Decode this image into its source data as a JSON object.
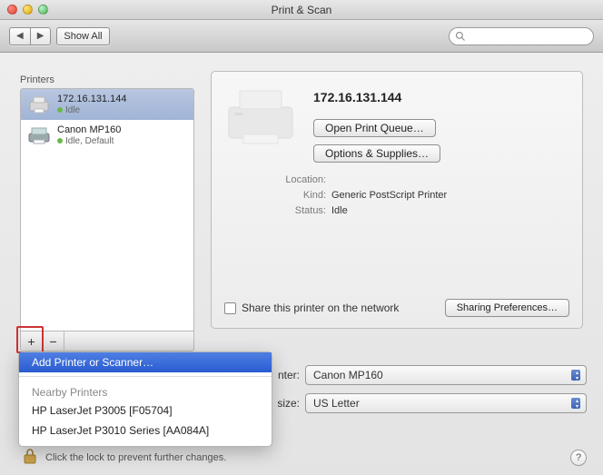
{
  "window": {
    "title": "Print & Scan"
  },
  "toolbar": {
    "show_all": "Show All"
  },
  "sidebar": {
    "heading": "Printers",
    "items": [
      {
        "name": "172.16.131.144",
        "status": "Idle",
        "selected": true
      },
      {
        "name": "Canon MP160",
        "status": "Idle, Default",
        "selected": false
      }
    ]
  },
  "detail": {
    "title": "172.16.131.144",
    "open_queue": "Open Print Queue…",
    "options_supplies": "Options & Supplies…",
    "labels": {
      "location": "Location:",
      "kind": "Kind:",
      "status": "Status:"
    },
    "values": {
      "location": "",
      "kind": "Generic PostScript Printer",
      "status": "Idle"
    },
    "share_label": "Share this printer on the network",
    "sharing_prefs": "Sharing Preferences…"
  },
  "popup": {
    "add": "Add Printer or Scanner…",
    "nearby_heading": "Nearby Printers",
    "nearby": [
      "HP LaserJet P3005 [F05704]",
      "HP LaserJet P3010 Series [AA084A]"
    ]
  },
  "defaults": {
    "printer_label_suffix": "nter:",
    "printer_value": "Canon MP160",
    "paper_label_suffix": "size:",
    "paper_value": "US Letter"
  },
  "footer": {
    "lock_text": "Click the lock to prevent further changes.",
    "help": "?"
  }
}
